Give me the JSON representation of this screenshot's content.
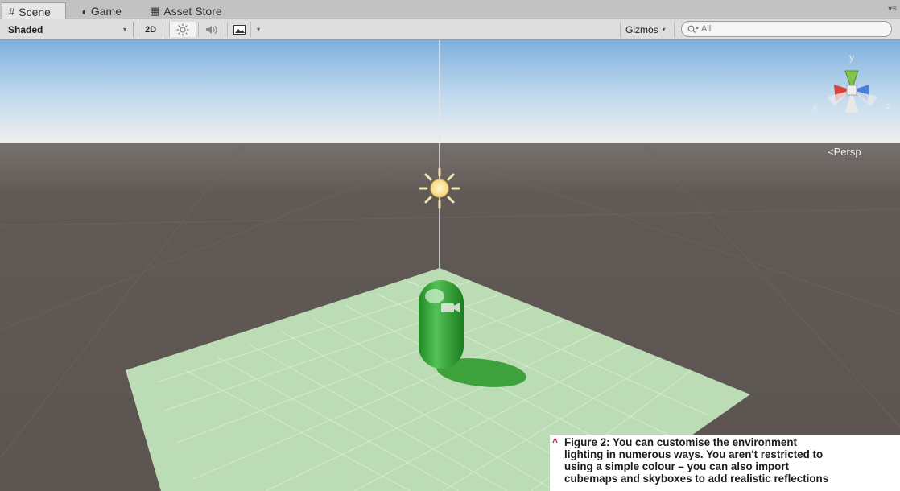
{
  "tabs": [
    {
      "label": "Scene",
      "icon": "#",
      "active": true
    },
    {
      "label": "Game",
      "icon": "game-controller",
      "active": false
    },
    {
      "label": "Asset Store",
      "icon": "shopping-bag",
      "active": false
    }
  ],
  "tab_menu": "▾≡",
  "toolbar": {
    "draw_mode": "Shaded",
    "mode_2d": "2D",
    "gizmos": "Gizmos",
    "search_placeholder": "All"
  },
  "scene": {
    "view_label": "Persp",
    "axes": {
      "x": "x",
      "y": "y",
      "z": "z"
    }
  },
  "caption": {
    "label": "Figure 2:",
    "lines": [
      " You can customise the environment",
      "lighting in numerous ways. You aren't restricted to",
      "using a simple colour – you can also import",
      "cubemaps and skyboxes to add realistic reflections"
    ]
  },
  "colors": {
    "sky_top": "#7fb0de",
    "sky_horizon": "#f1f1ec",
    "ground": "#5d5652",
    "plane": "#bcdcb5",
    "capsule": "#35a535",
    "caption_accent": "#e3163f"
  }
}
